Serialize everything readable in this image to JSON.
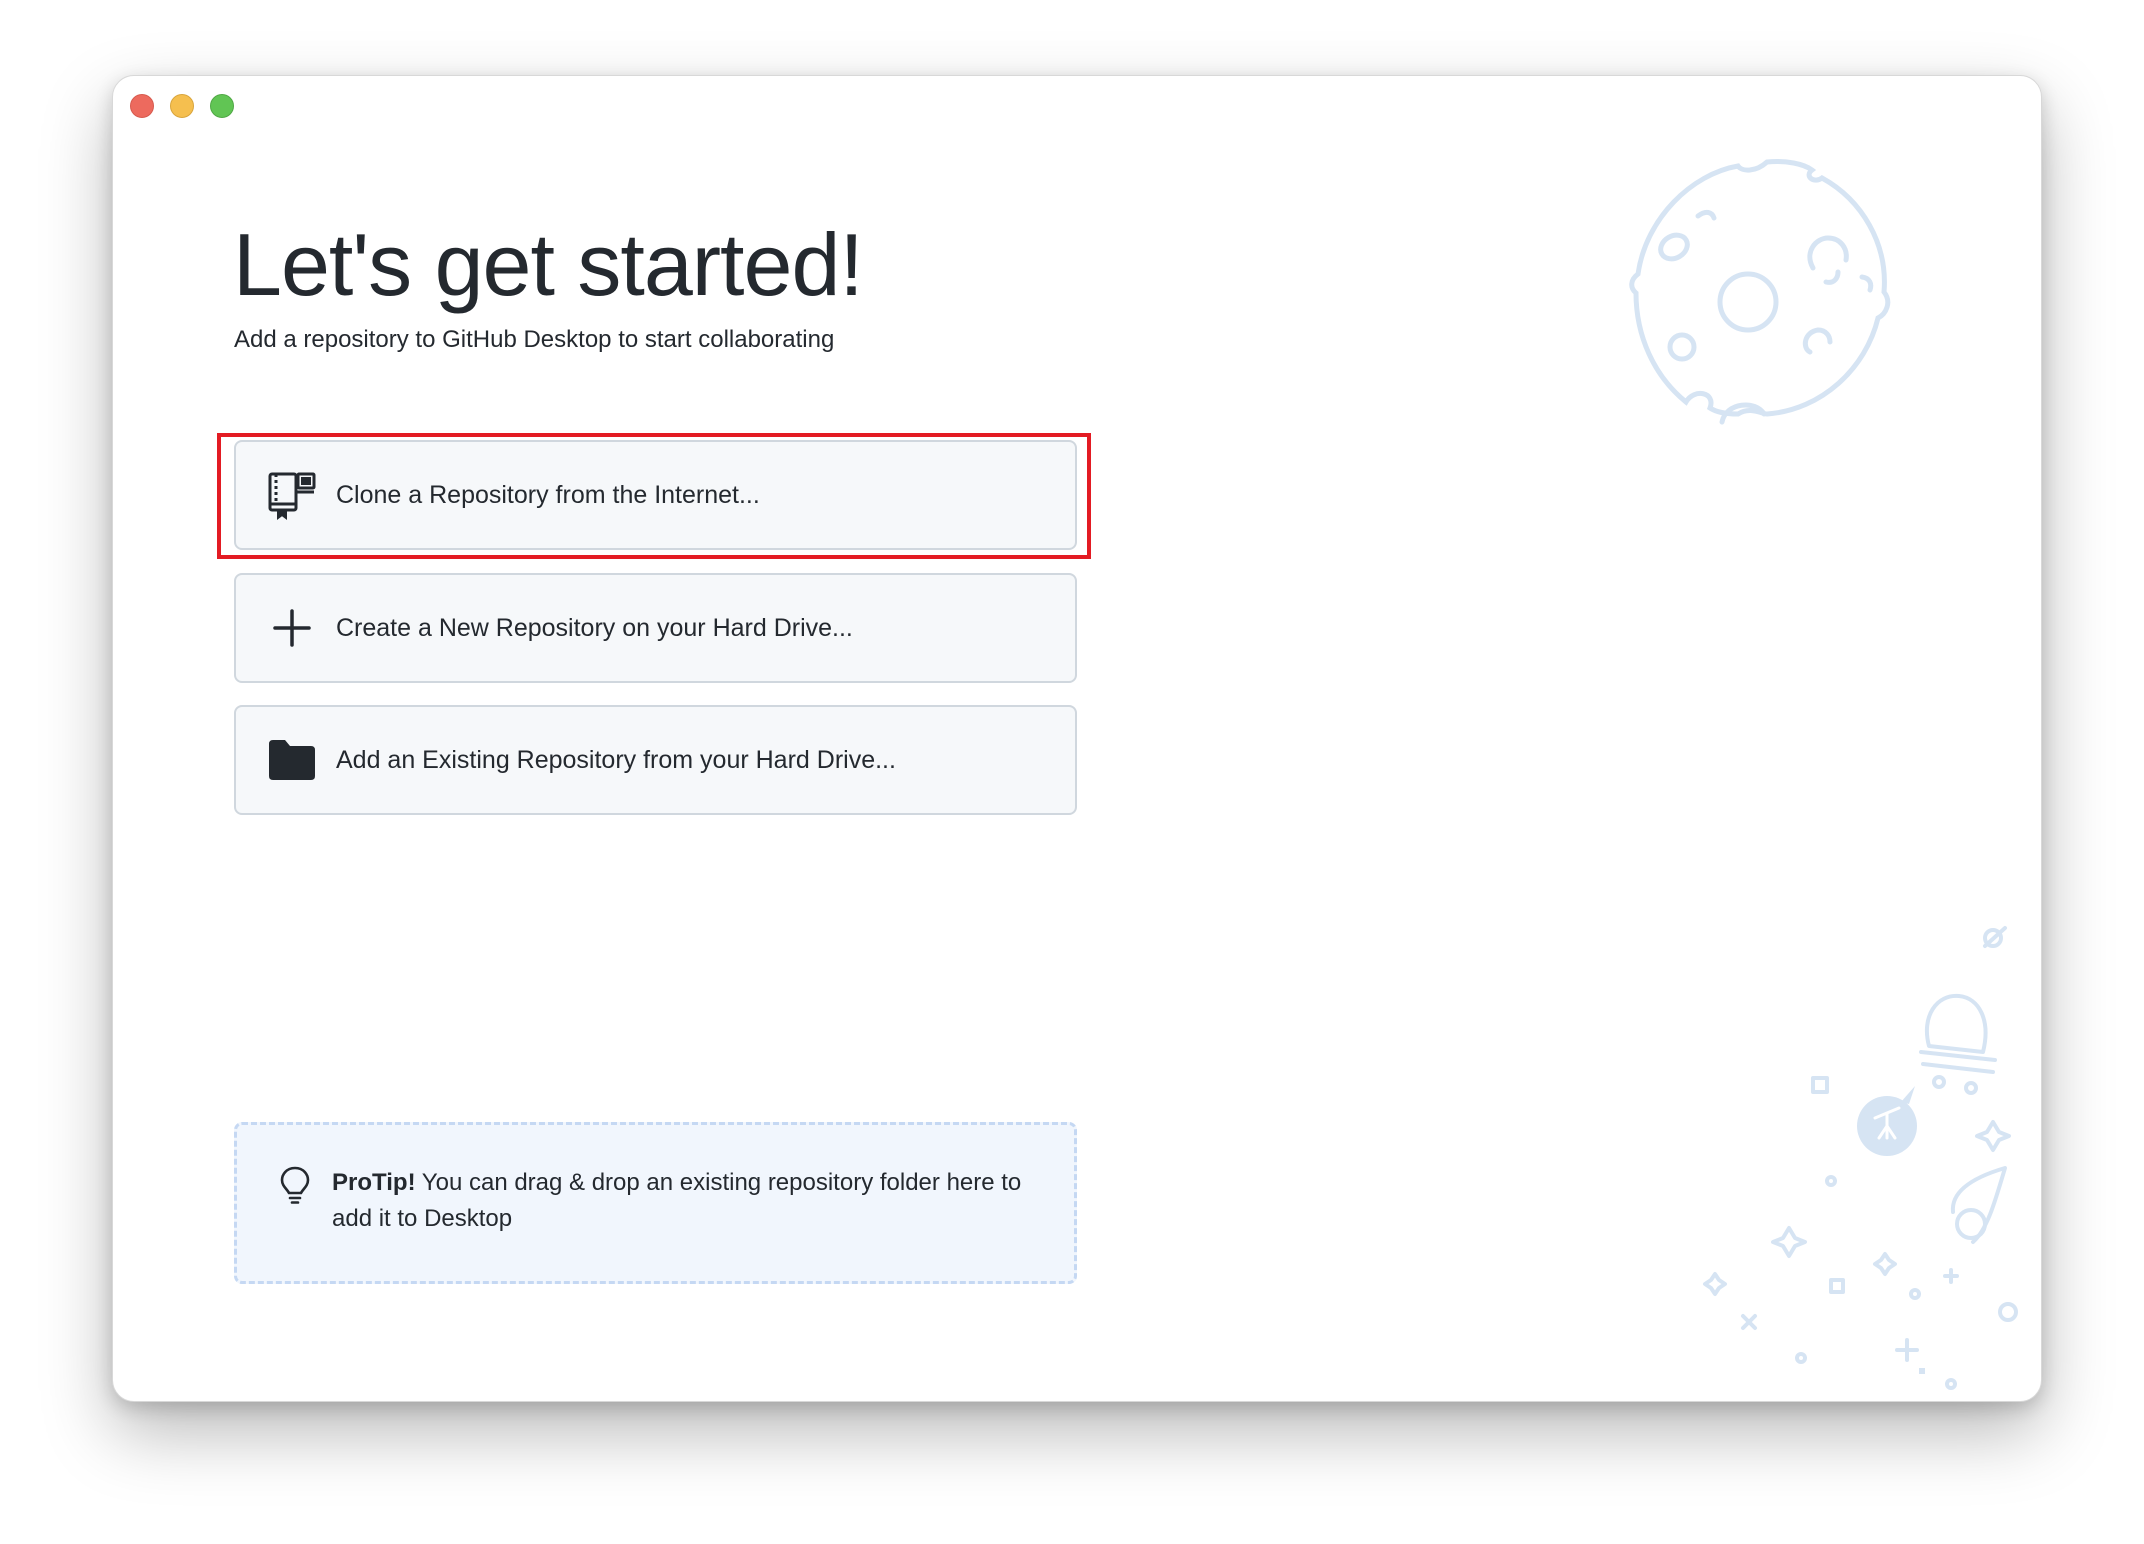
{
  "window": {
    "traffic_lights": [
      "close",
      "minimize",
      "zoom"
    ]
  },
  "welcome": {
    "title": "Let's get started!",
    "subtitle": "Add a repository to GitHub Desktop to start collaborating"
  },
  "actions": [
    {
      "label": "Clone a Repository from the Internet...",
      "icon": "clone-repo-icon",
      "highlighted": true
    },
    {
      "label": "Create a New Repository on your Hard Drive...",
      "icon": "plus-icon",
      "highlighted": false
    },
    {
      "label": "Add an Existing Repository from your Hard Drive...",
      "icon": "folder-icon",
      "highlighted": false
    }
  ],
  "protip": {
    "heading": "ProTip!",
    "body": " You can drag & drop an existing repository folder here to add it to Desktop",
    "icon": "lightbulb-icon"
  },
  "colors": {
    "accent_highlight": "#e31b23",
    "illustration": "#d6e4f3",
    "protip_bg": "#f1f6fd"
  }
}
